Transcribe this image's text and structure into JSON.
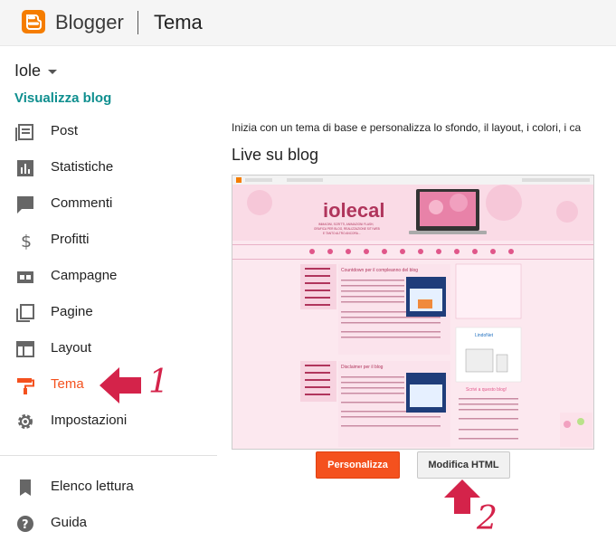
{
  "header": {
    "brand": "Blogger",
    "section": "Tema"
  },
  "blog": {
    "name": "Iole",
    "view_link": "Visualizza blog"
  },
  "nav": [
    {
      "label": "Post",
      "icon": "post-icon"
    },
    {
      "label": "Statistiche",
      "icon": "stats-icon"
    },
    {
      "label": "Commenti",
      "icon": "comments-icon"
    },
    {
      "label": "Profitti",
      "icon": "dollar-icon"
    },
    {
      "label": "Campagne",
      "icon": "campaign-icon"
    },
    {
      "label": "Pagine",
      "icon": "pages-icon"
    },
    {
      "label": "Layout",
      "icon": "layout-icon"
    },
    {
      "label": "Tema",
      "icon": "theme-roller-icon",
      "active": true
    },
    {
      "label": "Impostazioni",
      "icon": "gear-icon"
    }
  ],
  "nav_secondary": [
    {
      "label": "Elenco lettura",
      "icon": "bookmark-icon"
    },
    {
      "label": "Guida",
      "icon": "help-icon"
    }
  ],
  "main": {
    "intro": "Inizia con un tema di base e personalizza lo sfondo, il layout, i colori, i ca",
    "live_title": "Live su blog",
    "preview": {
      "blog_title": "iolecal",
      "tagline1": "IMMAGINI, SCRITTI, ANIMAZIONI FLASH,",
      "tagline2": "GRAFICA PER BLOG, REALIZZAZIONE SITI WEB",
      "tagline3": "E TANTO ALTRO ANCORA...",
      "post1_title": "Countdown per il compleanno del blog",
      "post2_title": "Disclaimer per il blog",
      "widget_title": "Scrivi a questo blog!",
      "widget_brand": "LindoNet"
    },
    "customize_button": "Personalizza",
    "edit_html_button": "Modifica HTML"
  },
  "annotations": {
    "step1": "1",
    "step2": "2",
    "arrow_color": "#d4234a"
  },
  "colors": {
    "accent": "#f4511e",
    "link": "#0f8f8f",
    "logo": "#f57d00"
  }
}
